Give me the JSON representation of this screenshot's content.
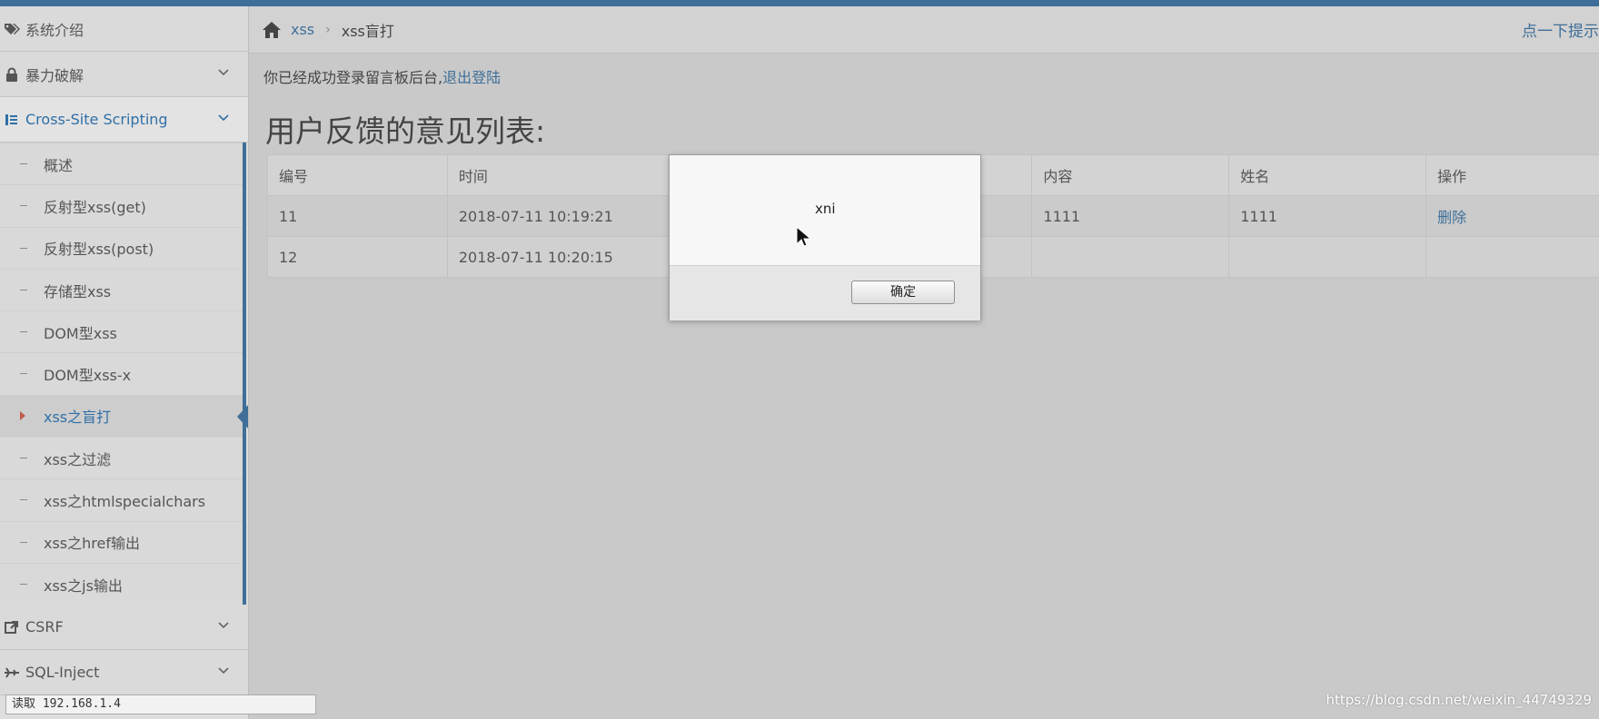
{
  "colors": {
    "accent": "#3f6f98",
    "bullet": "#c15a4b"
  },
  "sidebar": {
    "top_items": [
      {
        "label": "系统介绍",
        "icon": "tags-icon"
      },
      {
        "label": "暴力破解",
        "icon": "lock-icon"
      },
      {
        "label": "Cross-Site Scripting",
        "icon": "sitemap-icon"
      }
    ],
    "sub_items": [
      "概述",
      "反射型xss(get)",
      "反射型xss(post)",
      "存储型xss",
      "DOM型xss",
      "DOM型xss-x",
      "xss之盲打",
      "xss之过滤",
      "xss之htmlspecialchars",
      "xss之href输出",
      "xss之js输出"
    ],
    "active_sub": "xss之盲打",
    "bottom_items": [
      {
        "label": "CSRF",
        "icon": "external-link-icon"
      },
      {
        "label": "SQL-Inject",
        "icon": "plane-icon"
      }
    ]
  },
  "breadcrumb": {
    "link": "xss",
    "current": "xss盲打",
    "hint": "点一下提示"
  },
  "login_message": {
    "text": "你已经成功登录留言板后台,",
    "logout": "退出登陆"
  },
  "page_title": "用户反馈的意见列表:",
  "table": {
    "headers": [
      "编号",
      "时间",
      "",
      "内容",
      "姓名",
      "操作"
    ],
    "rows": [
      [
        "11",
        "2018-07-11 10:19:21",
        "",
        "1111",
        "1111",
        "删除"
      ],
      [
        "12",
        "2018-07-11 10:20:15",
        "",
        "",
        "",
        ""
      ]
    ]
  },
  "alert": {
    "message": "xni",
    "ok_label": "确定"
  },
  "statusbar": {
    "text": "读取 192.168.1.4"
  },
  "watermark": "https://blog.csdn.net/weixin_44749329"
}
